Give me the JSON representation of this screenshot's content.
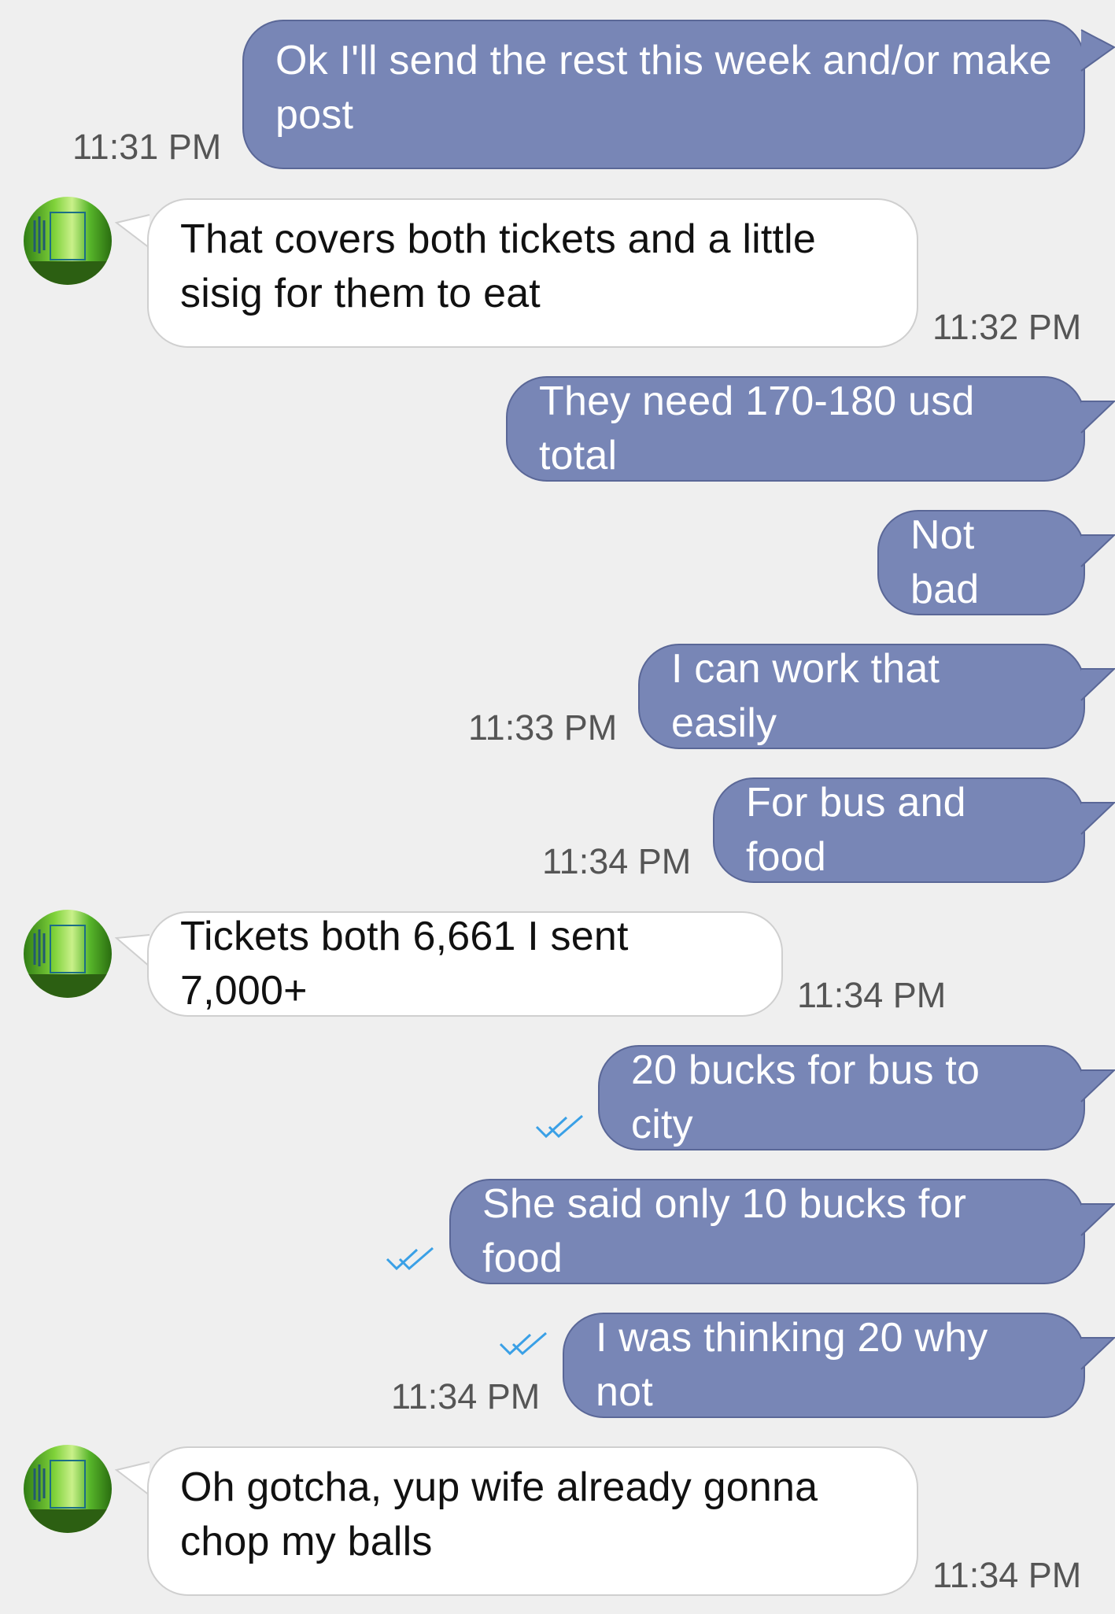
{
  "colors": {
    "outgoing_bubble": "#7886b6",
    "incoming_bubble": "#ffffff",
    "background": "#efefef",
    "read_tick": "#3aa0e6",
    "timestamp": "#555555"
  },
  "contact": {
    "avatar_icon": "contact-avatar-icon"
  },
  "messages": [
    {
      "direction": "outgoing",
      "text": "Ok I'll send the rest this week and/or make post",
      "time": "11:31 PM"
    },
    {
      "direction": "incoming",
      "text": "That covers both tickets and a little sisig for them to eat",
      "time": "11:32 PM"
    },
    {
      "direction": "outgoing",
      "text": "They need 170-180 usd total",
      "time": ""
    },
    {
      "direction": "outgoing",
      "text": "Not bad",
      "time": ""
    },
    {
      "direction": "outgoing",
      "text": "I can work that easily",
      "time": "11:33 PM"
    },
    {
      "direction": "outgoing",
      "text": "For bus and food",
      "time": "11:34 PM"
    },
    {
      "direction": "incoming",
      "text": "Tickets both 6,661 I sent 7,000+",
      "time": "11:34 PM"
    },
    {
      "direction": "outgoing",
      "text": "20 bucks for bus to city",
      "time": "",
      "status": "read"
    },
    {
      "direction": "outgoing",
      "text": "She said only 10 bucks for food",
      "time": "",
      "status": "read"
    },
    {
      "direction": "outgoing",
      "text": "I was thinking 20 why not",
      "time": "11:34 PM",
      "status": "read"
    },
    {
      "direction": "incoming",
      "text": "Oh gotcha, yup wife already gonna chop my balls",
      "time": "11:34 PM"
    }
  ]
}
